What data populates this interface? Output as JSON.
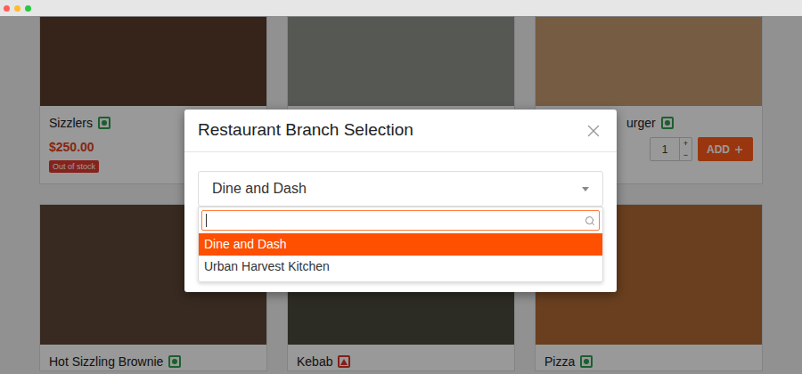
{
  "browser": {
    "dots": [
      {
        "color": "#ff5f57"
      },
      {
        "color": "#febc2e"
      },
      {
        "color": "#28c840"
      }
    ]
  },
  "cards": [
    {
      "title": "Sizzlers",
      "kind": "veg",
      "color": "#2e9e4f",
      "price": "$250.00",
      "badge": "Out of stock"
    },
    {},
    {
      "title": "urger",
      "kind": "veg",
      "color": "#2e9e4f",
      "quantity": {
        "value": "1",
        "increment": "+",
        "decrement": "−"
      },
      "button": "ADD"
    },
    {
      "title": "Hot Sizzling Brownie",
      "kind": "veg",
      "color": "#2e9e4f"
    },
    {
      "title": "Kebab",
      "kind": "non-veg",
      "color": "#d9342b"
    },
    {
      "title": "Pizza",
      "kind": "veg",
      "color": "#2e9e4f"
    }
  ],
  "modal": {
    "title": "Restaurant Branch Selection",
    "select": {
      "value": "Dine and Dash",
      "open": true
    },
    "options": [
      {
        "label": "Dine and Dash",
        "selected": true
      },
      {
        "label": "Urban Harvest Kitchen",
        "selected": false
      }
    ]
  }
}
